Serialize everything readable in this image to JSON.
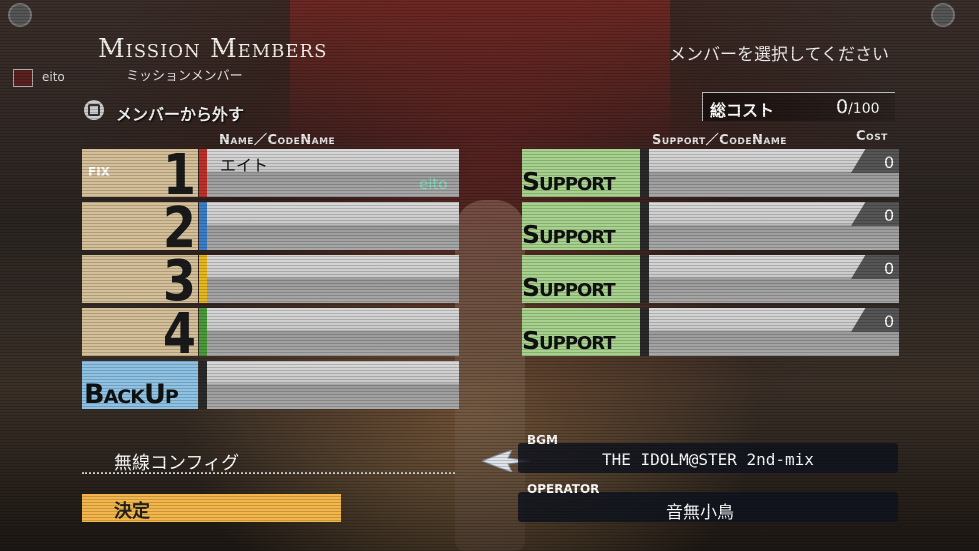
{
  "title": {
    "en": "Mission Members",
    "jp": "ミッションメンバー"
  },
  "instruction": "メンバーを選択してください",
  "player": {
    "name": "eito"
  },
  "remove_action": {
    "label": "メンバーから外す",
    "button_icon": "square-button-icon"
  },
  "total_cost": {
    "label": "総コスト",
    "value": "0",
    "max": "/100"
  },
  "headers": {
    "members": "Name／CodeName",
    "support": "Support／CodeName",
    "cost": "Cost"
  },
  "members": [
    {
      "slot": "1",
      "fix": "FIX",
      "name": "エイト",
      "codename": "eito",
      "stripe_color": "#c0302a"
    },
    {
      "slot": "2",
      "fix": "",
      "name": "",
      "codename": "",
      "stripe_color": "#3a7ec8"
    },
    {
      "slot": "3",
      "fix": "",
      "name": "",
      "codename": "",
      "stripe_color": "#e6b820"
    },
    {
      "slot": "4",
      "fix": "",
      "name": "",
      "codename": "",
      "stripe_color": "#4a9a3a"
    }
  ],
  "backup": {
    "label": "BackUp",
    "name": ""
  },
  "supports": [
    {
      "label": "Support",
      "name": "",
      "cost": "0"
    },
    {
      "label": "Support",
      "name": "",
      "cost": "0"
    },
    {
      "label": "Support",
      "name": "",
      "cost": "0"
    },
    {
      "label": "Support",
      "name": "",
      "cost": "0"
    }
  ],
  "menu": {
    "config": "無線コンフィグ",
    "confirm": "決定"
  },
  "bgm": {
    "label": "BGM",
    "value": "THE IDOLM@STER 2nd-mix"
  },
  "operator": {
    "label": "OPERATOR",
    "value": "音無小鳥"
  },
  "colors": {
    "fix_slot": "#d4bf98",
    "backup": "#8ec2e4",
    "support": "#a6d28e",
    "confirm": "#f3b64a"
  }
}
